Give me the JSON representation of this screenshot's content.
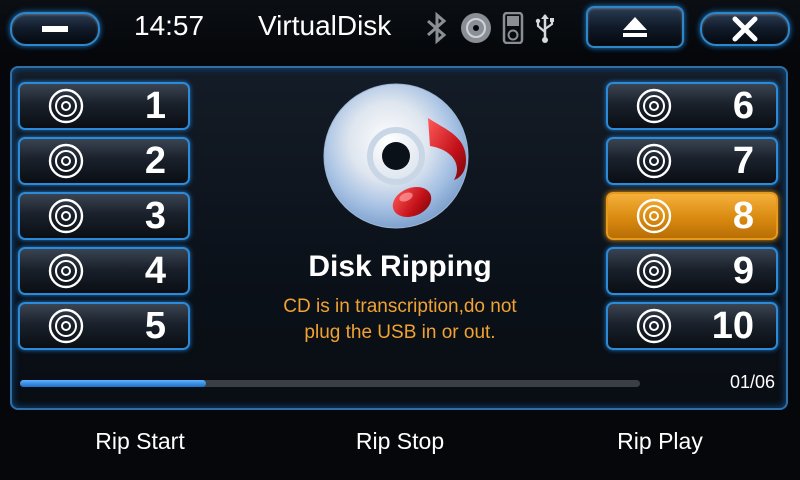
{
  "topbar": {
    "time": "14:57",
    "title": "VirtualDisk",
    "status_icons": [
      "bluetooth-icon",
      "disc-icon",
      "ipod-icon",
      "usb-icon"
    ],
    "eject_icon": "eject-icon",
    "close_icon": "close-icon",
    "minimize_icon": "minimize-icon"
  },
  "tracks_left": [
    {
      "number": "1",
      "icon": "disc-icon"
    },
    {
      "number": "2",
      "icon": "disc-icon"
    },
    {
      "number": "3",
      "icon": "disc-icon"
    },
    {
      "number": "4",
      "icon": "disc-icon"
    },
    {
      "number": "5",
      "icon": "disc-icon"
    }
  ],
  "tracks_right": [
    {
      "number": "6",
      "icon": "disc-icon"
    },
    {
      "number": "7",
      "icon": "disc-icon"
    },
    {
      "number": "8",
      "icon": "disc-icon",
      "selected": true
    },
    {
      "number": "9",
      "icon": "disc-icon"
    },
    {
      "number": "10",
      "icon": "disc-icon"
    }
  ],
  "main": {
    "heading": "Disk Ripping",
    "message_line1": "CD is in transcription,do not",
    "message_line2": "plug the USB in or out.",
    "progress_fraction": 0.3,
    "page_indicator": "01/06"
  },
  "bottom": {
    "rip_start": "Rip Start",
    "rip_stop": "Rip Stop",
    "rip_play": "Rip Play"
  },
  "colors": {
    "accent_blue": "#2c8ad6",
    "selected_orange": "#e69a1c",
    "message_orange": "#f1a233"
  }
}
